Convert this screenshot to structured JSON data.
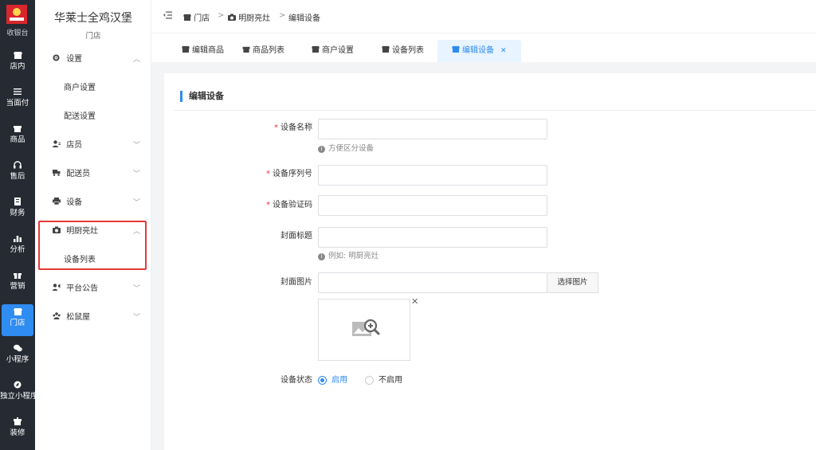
{
  "rail": {
    "logo_label": "收银台",
    "items": [
      {
        "label": "店内",
        "icon": "store-icon"
      },
      {
        "label": "当面付",
        "icon": "list-icon"
      },
      {
        "label": "商品",
        "icon": "shop-icon"
      },
      {
        "label": "售后",
        "icon": "headset-icon"
      },
      {
        "label": "财务",
        "icon": "ledger-icon"
      },
      {
        "label": "分析",
        "icon": "bar-chart-icon"
      },
      {
        "label": "营销",
        "icon": "gift-icon"
      },
      {
        "label": "门店",
        "icon": "store-icon"
      },
      {
        "label": "小程序",
        "icon": "wechat-icon"
      },
      {
        "label": "独立小程序",
        "icon": "compass-icon"
      },
      {
        "label": "装修",
        "icon": "brush-icon"
      }
    ]
  },
  "sidebar": {
    "store_name": "华莱士全鸡汉堡",
    "store_sub": "门店",
    "groups": [
      {
        "label": "设置",
        "icon": "gear-icon",
        "expanded": true,
        "children": [
          "商户设置",
          "配送设置"
        ]
      },
      {
        "label": "店员",
        "icon": "staff-icon",
        "expanded": false
      },
      {
        "label": "配送员",
        "icon": "delivery-icon",
        "expanded": false
      },
      {
        "label": "设备",
        "icon": "printer-icon",
        "expanded": false
      },
      {
        "label": "明厨亮灶",
        "icon": "camera-icon",
        "expanded": true,
        "children": [
          "设备列表"
        ]
      },
      {
        "label": "平台公告",
        "icon": "announcement-icon",
        "expanded": false
      },
      {
        "label": "松鼠屋",
        "icon": "group-icon",
        "expanded": false
      }
    ]
  },
  "breadcrumb": {
    "toggle_icon": "menu-fold-icon",
    "items": [
      "门店",
      "明厨亮灶",
      "编辑设备"
    ],
    "separator": ">"
  },
  "tabs": [
    {
      "label": "编辑商品",
      "active": false
    },
    {
      "label": "商品列表",
      "active": false
    },
    {
      "label": "商户设置",
      "active": false
    },
    {
      "label": "设备列表",
      "active": false
    },
    {
      "label": "编辑设备",
      "active": true,
      "closable": true
    }
  ],
  "form": {
    "title": "编辑设备",
    "fields": {
      "device_name": {
        "label": "设备名称",
        "required": true,
        "value": "",
        "hint": "方便区分设备"
      },
      "serial_no": {
        "label": "设备序列号",
        "required": true,
        "value": ""
      },
      "verify_code": {
        "label": "设备验证码",
        "required": true,
        "value": ""
      },
      "cover_title": {
        "label": "封面标题",
        "required": false,
        "value": "",
        "hint": "例如: 明厨亮灶"
      },
      "cover_image": {
        "label": "封面图片",
        "value": "",
        "button": "选择图片"
      },
      "status": {
        "label": "设备状态",
        "options": [
          "启用",
          "不启用"
        ],
        "selected": "启用"
      }
    }
  },
  "colors": {
    "accent": "#2d8cf0",
    "rail_bg": "#262b33",
    "highlight": "#e53935",
    "required": "#e53935"
  }
}
